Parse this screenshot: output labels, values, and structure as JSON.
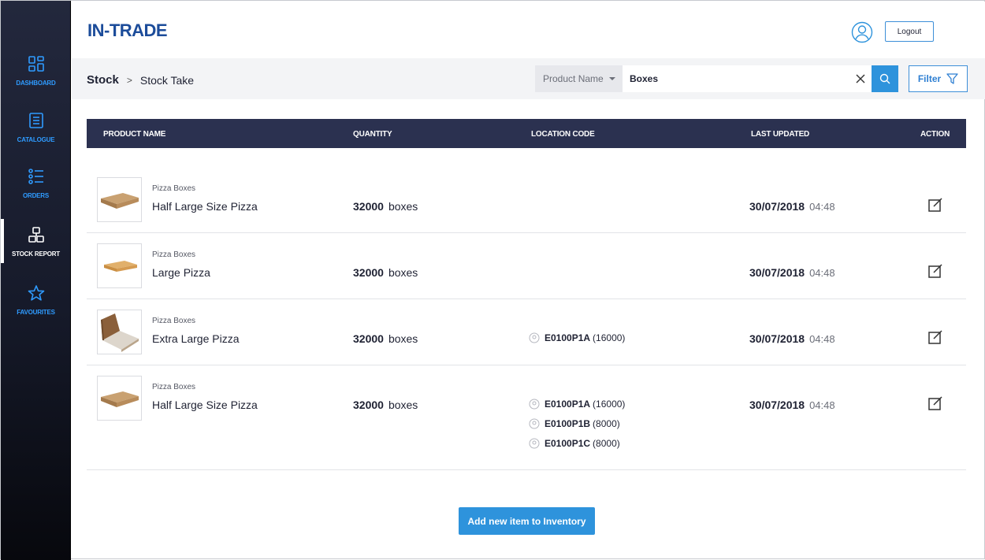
{
  "app": {
    "logo_text": "IN-TRADE",
    "logout_label": "Logout"
  },
  "sidebar": {
    "items": [
      {
        "label": "DASHBOARD",
        "icon": "dashboard-icon",
        "active": false
      },
      {
        "label": "CATALOGUE",
        "icon": "catalogue-icon",
        "active": false
      },
      {
        "label": "ORDERS",
        "icon": "orders-icon",
        "active": false
      },
      {
        "label": "STOCK REPORT",
        "icon": "stock-report-icon",
        "active": true
      },
      {
        "label": "FAVOURITES",
        "icon": "star-icon",
        "active": false
      }
    ]
  },
  "breadcrumb": {
    "root": "Stock",
    "separator": ">",
    "current": "Stock Take"
  },
  "search": {
    "field_label": "Product Name",
    "value": "Boxes"
  },
  "filter": {
    "label": "Filter"
  },
  "table": {
    "headers": {
      "product_name": "PRODUCT NAME",
      "quantity": "QUANTITY",
      "location_code": "LOCATION CODE",
      "last_updated": "LAST UPDATED",
      "action": "ACTION"
    },
    "rows": [
      {
        "category": "Pizza Boxes",
        "name": "Half Large Size Pizza",
        "qty": "32000",
        "unit": "boxes",
        "locations": [],
        "date": "30/07/2018",
        "time": "04:48"
      },
      {
        "category": "Pizza Boxes",
        "name": "Large Pizza",
        "qty": "32000",
        "unit": "boxes",
        "locations": [],
        "date": "30/07/2018",
        "time": "04:48"
      },
      {
        "category": "Pizza Boxes",
        "name": "Extra Large Pizza",
        "qty": "32000",
        "unit": "boxes",
        "locations": [
          {
            "code": "E0100P1A",
            "count": "(16000)"
          }
        ],
        "date": "30/07/2018",
        "time": "04:48"
      },
      {
        "category": "Pizza Boxes",
        "name": "Half Large Size Pizza",
        "qty": "32000",
        "unit": "boxes",
        "locations": [
          {
            "code": "E0100P1A",
            "count": "(16000)"
          },
          {
            "code": "E0100P1B",
            "count": "(8000)"
          },
          {
            "code": "E0100P1C",
            "count": "(8000)"
          }
        ],
        "date": "30/07/2018",
        "time": "04:48"
      }
    ]
  },
  "add_button": {
    "label": "Add new item to Inventory"
  },
  "colors": {
    "accent": "#2e93dc",
    "header_bg": "#2b3150",
    "logo": "#1c4c9a",
    "nav_label": "#2f9bff"
  }
}
